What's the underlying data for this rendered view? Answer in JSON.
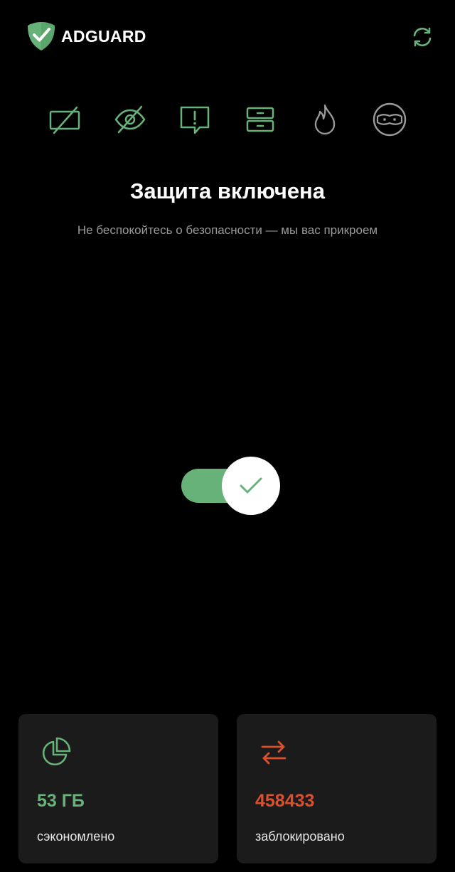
{
  "header": {
    "brand": "ADGUARD",
    "logo_icon": "adguard-shield-icon",
    "refresh_icon": "refresh-icon"
  },
  "features": [
    {
      "name": "ad-blocking",
      "icon": "crossed-screen-icon"
    },
    {
      "name": "tracking-protection",
      "icon": "crossed-eye-icon"
    },
    {
      "name": "annoyance-blocking",
      "icon": "alert-message-icon"
    },
    {
      "name": "dns-protection",
      "icon": "server-icon"
    },
    {
      "name": "firewall",
      "icon": "flame-icon"
    },
    {
      "name": "stealth-mode",
      "icon": "ninja-icon"
    }
  ],
  "status": {
    "title": "Защита включена",
    "subtitle": "Не беспокойтесь о безопасности — мы вас прикроем",
    "protection_enabled": true
  },
  "stats": {
    "saved": {
      "value": "53 ГБ",
      "label": "сэкономлено",
      "icon": "pie-chart-icon"
    },
    "blocked": {
      "value": "458433",
      "label": "заблокировано",
      "icon": "swap-arrows-icon"
    }
  },
  "colors": {
    "accent_green": "#67b279",
    "accent_red": "#d9502c",
    "background": "#000000",
    "card_background": "#1b1b1b",
    "icon_gray": "#9a9a9a"
  }
}
